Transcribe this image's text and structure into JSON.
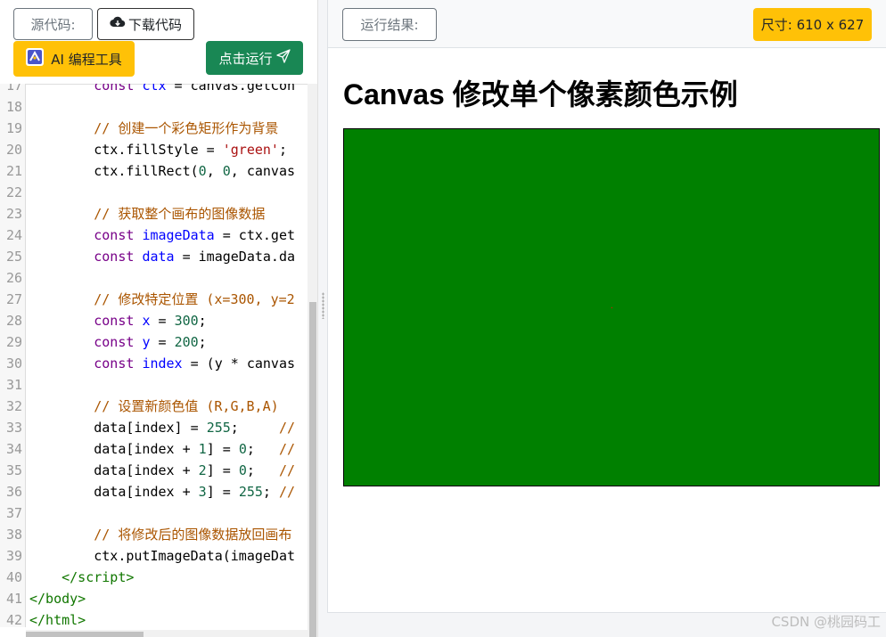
{
  "left_toolbar": {
    "source_label": "源代码:",
    "download_label": "下载代码",
    "ai_label": "AI 编程工具",
    "run_label": "点击运行"
  },
  "code": {
    "lines": [
      {
        "n": "17",
        "html": "        <span class='kw'>const</span> <span class='def'>ctx</span> = canvas.getCon"
      },
      {
        "n": "18",
        "html": ""
      },
      {
        "n": "19",
        "html": "        <span class='cm'>// 创建一个彩色矩形作为背景</span>"
      },
      {
        "n": "20",
        "html": "        ctx.fillStyle = <span class='str'>'green'</span>;"
      },
      {
        "n": "21",
        "html": "        ctx.fillRect(<span class='num'>0</span>, <span class='num'>0</span>, canvas"
      },
      {
        "n": "22",
        "html": ""
      },
      {
        "n": "23",
        "html": "        <span class='cm'>// 获取整个画布的图像数据</span>"
      },
      {
        "n": "24",
        "html": "        <span class='kw'>const</span> <span class='def'>imageData</span> = ctx.get"
      },
      {
        "n": "25",
        "html": "        <span class='kw'>const</span> <span class='def'>data</span> = imageData.da"
      },
      {
        "n": "26",
        "html": ""
      },
      {
        "n": "27",
        "html": "        <span class='cm'>// 修改特定位置 (x=300, y=2</span>"
      },
      {
        "n": "28",
        "html": "        <span class='kw'>const</span> <span class='def'>x</span> = <span class='num'>300</span>;"
      },
      {
        "n": "29",
        "html": "        <span class='kw'>const</span> <span class='def'>y</span> = <span class='num'>200</span>;"
      },
      {
        "n": "30",
        "html": "        <span class='kw'>const</span> <span class='def'>index</span> = (y * canvas"
      },
      {
        "n": "31",
        "html": ""
      },
      {
        "n": "32",
        "html": "        <span class='cm'>// 设置新颜色值 (R,G,B,A)</span>"
      },
      {
        "n": "33",
        "html": "        data[index] = <span class='num'>255</span>;     <span class='cm'>//</span>"
      },
      {
        "n": "34",
        "html": "        data[index + <span class='num'>1</span>] = <span class='num'>0</span>;   <span class='cm'>//</span>"
      },
      {
        "n": "35",
        "html": "        data[index + <span class='num'>2</span>] = <span class='num'>0</span>;   <span class='cm'>//</span>"
      },
      {
        "n": "36",
        "html": "        data[index + <span class='num'>3</span>] = <span class='num'>255</span>; <span class='cm'>//</span>"
      },
      {
        "n": "37",
        "html": ""
      },
      {
        "n": "38",
        "html": "        <span class='cm'>// 将修改后的图像数据放回画布</span>"
      },
      {
        "n": "39",
        "html": "        ctx.putImageData(imageDat"
      },
      {
        "n": "40",
        "html": "    <span class='tag'>&lt;/script&gt;</span>"
      },
      {
        "n": "41",
        "html": "<span class='tag'>&lt;/body&gt;</span>"
      },
      {
        "n": "42",
        "html": "<span class='tag'>&lt;/html&gt;</span>"
      }
    ]
  },
  "right_header": {
    "result_label": "运行结果:",
    "size_label": "尺寸: 610 x 627"
  },
  "preview": {
    "title": "Canvas 修改单个像素颜色示例",
    "canvas_fill": "#008000",
    "pixel_color": "#ff0000"
  },
  "watermark": "CSDN @桃园码工",
  "colors": {
    "run_button": "#198754",
    "ai_button": "#ffc107",
    "size_badge": "#ffc107"
  },
  "icons": {
    "download": "cloud-download-icon",
    "ai": "ai-logo-icon",
    "run": "send-icon"
  }
}
